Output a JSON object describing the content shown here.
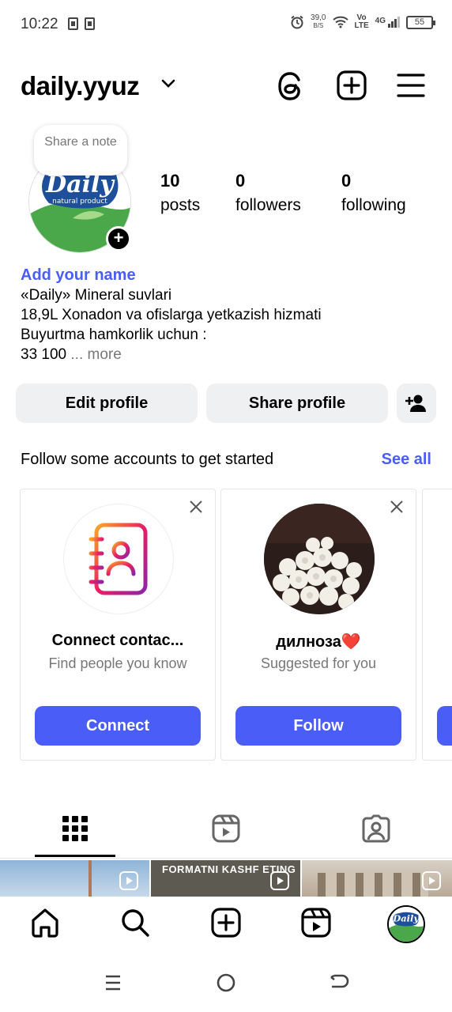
{
  "status_bar": {
    "time": "10:22",
    "speed_value": "39,0",
    "speed_unit": "B/S",
    "volte_top": "Vo",
    "volte_bottom": "LTE",
    "network": "4G",
    "battery": "55"
  },
  "header": {
    "username": "daily.yyuz",
    "icons": [
      "threads-icon",
      "add-post-icon",
      "menu-icon"
    ]
  },
  "profile": {
    "note_prompt": "Share a note",
    "avatar_brand": "Daily",
    "avatar_tagline": "natural product",
    "stats": [
      {
        "value": "10",
        "label": "posts"
      },
      {
        "value": "0",
        "label": "followers"
      },
      {
        "value": "0",
        "label": "following"
      }
    ],
    "add_name": "Add your name",
    "bio_lines": [
      "«Daily» Mineral suvlari",
      "18,9L Xonadon va ofislarga yetkazish hizmati",
      "Buyurtma hamkorlik uchun :",
      "33 100"
    ],
    "more_ellipsis": "...",
    "more_label": "more"
  },
  "actions": {
    "edit_profile": "Edit profile",
    "share_profile": "Share profile"
  },
  "suggestions": {
    "heading": "Follow some accounts to get started",
    "see_all": "See all",
    "cards": [
      {
        "title": "Connect contac...",
        "subtitle": "Find people you know",
        "button": "Connect"
      },
      {
        "title": "дилноза❤️",
        "subtitle": "Suggested for you",
        "button": "Follow"
      }
    ]
  },
  "grid": {
    "thumb2_text": "FORMATNI KASHF ETING"
  },
  "colors": {
    "accent": "#4a5df6",
    "button_bg": "#eff0f2",
    "muted_text": "#777777"
  }
}
